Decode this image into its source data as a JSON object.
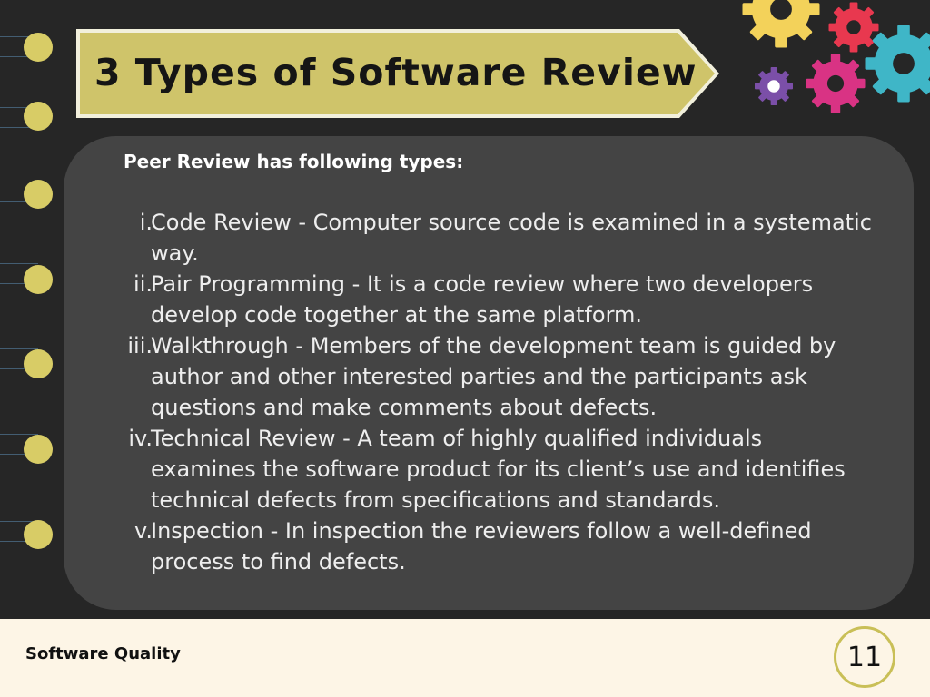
{
  "slide": {
    "title": "3 Types of Software Review",
    "intro": "Peer Review has following types:",
    "types": [
      {
        "num": "i.",
        "text": "Code Review - Computer source code is examined in a systematic way."
      },
      {
        "num": "ii.",
        "text": "Pair Programming - It is a code review where two developers develop code together at the same platform."
      },
      {
        "num": "iii.",
        "text": "Walkthrough - Members of the development team is guided by author and other interested parties and the participants ask questions and make comments about defects."
      },
      {
        "num": "iv.",
        "text": "Technical Review - A team of highly qualified individuals examines the software product for its client’s use and identifies technical defects from specifications and standards."
      },
      {
        "num": "v.",
        "text": "Inspection - In inspection the reviewers follow a well-defined process to find defects."
      }
    ]
  },
  "footer": {
    "label": "Software Quality",
    "page_number": "11"
  },
  "colors": {
    "background": "#262626",
    "card": "#444444",
    "banner": "#cfc46a",
    "ring": "#d8cc66",
    "footer": "#fdf5e6",
    "gear_colors": [
      "#f3d25a",
      "#e8384f",
      "#d93384",
      "#3fb6c7",
      "#7b4fa8"
    ]
  },
  "icons": [
    "binding-ring-icon",
    "gear-icon"
  ]
}
